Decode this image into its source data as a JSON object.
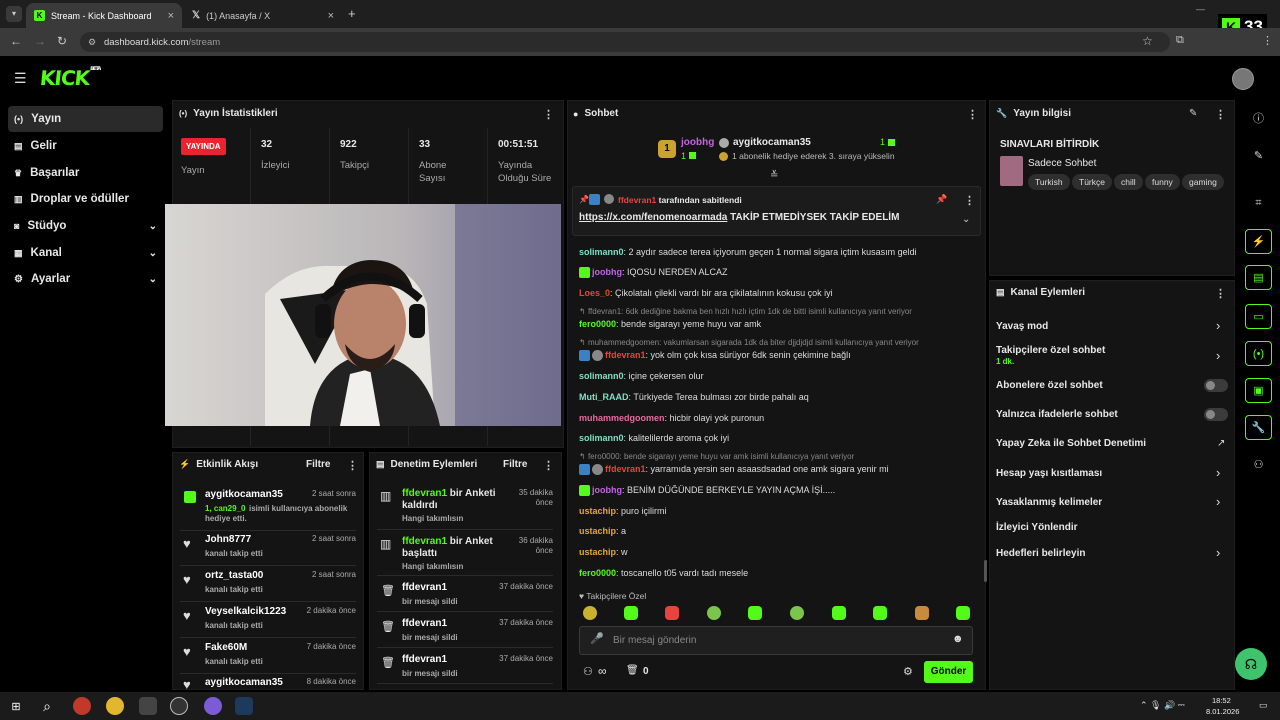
{
  "browser": {
    "tabs": [
      {
        "label": "Stream - Kick Dashboard",
        "active": true
      },
      {
        "label": "(1) Anasayfa / X",
        "active": false
      }
    ],
    "new_tab": "+",
    "url_domain": "dashboard.kick.com",
    "url_path": "/stream",
    "kick_badge": "33"
  },
  "sidebar": {
    "items": [
      {
        "label": "Yayın",
        "icon": "broadcast-icon"
      },
      {
        "label": "Gelir",
        "icon": "revenue-icon"
      },
      {
        "label": "Başarılar",
        "icon": "trophy-icon"
      },
      {
        "label": "Droplar ve ödüller",
        "icon": "gift-icon"
      },
      {
        "label": "Stüdyo",
        "icon": "studio-icon"
      },
      {
        "label": "Kanal",
        "icon": "channel-icon"
      },
      {
        "label": "Ayarlar",
        "icon": "gear-icon"
      }
    ]
  },
  "stats": {
    "title": "Yayın İstatistikleri",
    "live_badge": "YAYINDA",
    "live_label": "Yayın",
    "items": [
      {
        "value": "32",
        "label": "İzleyici"
      },
      {
        "value": "922",
        "label": "Takipçi"
      },
      {
        "value": "33",
        "label": "Abone Sayısı"
      },
      {
        "value": "00:51:51",
        "label": "Yayında Olduğu Süre"
      }
    ]
  },
  "activity": {
    "title": "Etkinlik Akışı",
    "filter": "Filtre",
    "items": [
      {
        "name": "aygitkocaman35",
        "time": "2 saat sonra",
        "sub_green": "1, can29_0",
        "sub": "isimli kullanıcıya abonelik hediye etti."
      },
      {
        "name": "John8777",
        "time": "2 saat sonra",
        "sub": "kanalı takip etti"
      },
      {
        "name": "ortz_tasta00",
        "time": "2 saat sonra",
        "sub": "kanalı takip etti"
      },
      {
        "name": "Veyselkalcik1223",
        "time": "2 dakika önce",
        "sub": "kanalı takip etti"
      },
      {
        "name": "Fake60M",
        "time": "7 dakika önce",
        "sub": "kanalı takip etti"
      },
      {
        "name": "aygitkocaman35",
        "time": "8 dakika önce",
        "sub": ""
      }
    ]
  },
  "moderation": {
    "title": "Denetim Eylemleri",
    "filter": "Filtre",
    "items": [
      {
        "name": "ffdevran1",
        "action": "bir Anketi kaldırdı",
        "time": "35 dakika önce",
        "sub": "Hangi takımlısın"
      },
      {
        "name": "ffdevran1",
        "action": "bir Anket başlattı",
        "time": "36 dakika önce",
        "sub": "Hangi takımlısın"
      },
      {
        "name": "ffdevran1",
        "action": "",
        "time": "37 dakika önce",
        "sub": "bir mesajı sildi"
      },
      {
        "name": "ffdevran1",
        "action": "",
        "time": "37 dakika önce",
        "sub": "bir mesajı sildi"
      },
      {
        "name": "ffdevran1",
        "action": "",
        "time": "37 dakika önce",
        "sub": "bir mesajı sildi"
      }
    ]
  },
  "chat": {
    "title": "Sohbet",
    "top_gifter": {
      "rank": "1",
      "name": "joobhg",
      "count": "1"
    },
    "gift_user": "aygitkocaman35",
    "gift_count": "1",
    "gift_text": "1 abonelik hediye ederek 3. sıraya yükselin",
    "pinned_by_user": "ffdevran1",
    "pinned_by_text": "tarafından sabitlendi",
    "pinned_link": "https://x.com/fenomenoarmada",
    "pinned_text": "TAKİP ETMEDİYSEK TAKİP EDELİM",
    "messages": [
      {
        "user": "solimann0",
        "color": "#7ee0c2",
        "text": "2 aydır sadece terea içiyorum geçen 1 normal sigara içtim kusasım geldi"
      },
      {
        "user": "joobhg",
        "color": "#c563e4",
        "text": "IQOSU NERDEN ALCAZ",
        "badge": true
      },
      {
        "user": "Loes_0",
        "color": "#e6453d",
        "text": "Çikolatalı çilekli vardı bir ara çikilatalının kokusu çok iyi"
      },
      {
        "reply": "ffdevran1: 6dk dediğine bakma ben hızlı hızlı içtim 1dk de bitti isimli kullanıcıya yanıt veriyor"
      },
      {
        "user": "fero0000",
        "color": "#53fc18",
        "text": "bende sigarayı yeme huyu var amk"
      },
      {
        "reply": "muhammedgoomen: vakumlarsan sigarada 1dk da biter djjdjdjd isimli kullanıcıya yanıt veriyor"
      },
      {
        "user": "ffdevran1",
        "color": "#e6453d",
        "text": "yok olm çok kısa sürüyor 6dk senin çekimine bağlı",
        "badge": true
      },
      {
        "user": "solimann0",
        "color": "#7ee0c2",
        "text": "içine çekersen olur"
      },
      {
        "user": "Muti_RAAD",
        "color": "#7ee0c2",
        "text": "Türkiyede Terea bulması zor birde pahalı aq"
      },
      {
        "user": "muhammedgoomen",
        "color": "#e46aa0",
        "text": "hicbir olayi yok puronun"
      },
      {
        "user": "solimann0",
        "color": "#7ee0c2",
        "text": "kalitelilerde aroma çok iyi"
      },
      {
        "reply": "fero0000: bende sigarayı yeme huyu var amk isimli kullanıcıya yanıt veriyor"
      },
      {
        "user": "ffdevran1",
        "color": "#e6453d",
        "text": "yarramıda yersin sen asaasdsadad one amk sigara yenir mi",
        "badge": true
      },
      {
        "user": "joobhg",
        "color": "#c563e4",
        "text": "BENİM DÜĞÜNDE BERKEYLE YAYIN AÇMA İŞİ.....",
        "badge": true
      },
      {
        "user": "ustachip",
        "color": "#e8a33a",
        "text": "puro içilirmi"
      },
      {
        "user": "ustachip",
        "color": "#e8a33a",
        "text": "a"
      },
      {
        "user": "ustachip",
        "color": "#e8a33a",
        "text": "w"
      },
      {
        "user": "fero0000",
        "color": "#53fc18",
        "text": "toscanello t05 vardı tadı mesele"
      }
    ],
    "followers_only_label": "Takipçilere Özel",
    "input_placeholder": "Bir mesaj gönderin",
    "infinity": "∞",
    "count": "0",
    "send_label": "Gönder"
  },
  "stream_info": {
    "title": "Yayın bilgisi",
    "stream_title": "SINAVLARI BİTİRDİK",
    "category": "Sadece Sohbet",
    "tags": [
      "Turkish",
      "Türkçe",
      "chill",
      "funny",
      "gaming"
    ]
  },
  "channel_actions": {
    "title": "Kanal Eylemleri",
    "items": [
      {
        "label": "Yavaş mod",
        "control": "chevron"
      },
      {
        "label": "Takipçilere özel sohbet",
        "sub": "1 dk.",
        "control": "chevron"
      },
      {
        "label": "Abonelere özel sohbet",
        "control": "toggle"
      },
      {
        "label": "Yalnızca ifadelerle sohbet",
        "control": "toggle"
      },
      {
        "label": "Yapay Zeka ile Sohbet Denetimi",
        "control": "external"
      },
      {
        "label": "Hesap yaşı kısıtlaması",
        "control": "chevron"
      },
      {
        "label": "Yasaklanmış kelimeler",
        "control": "chevron"
      },
      {
        "label": "İzleyici Yönlendir",
        "control": "none"
      },
      {
        "label": "Hedefleri belirleyin",
        "control": "chevron"
      }
    ]
  },
  "taskbar": {
    "time": "18:52",
    "date": "8.01.2026"
  },
  "colors": {
    "accent": "#53fc18",
    "live": "#e9242e",
    "panel": "#141414"
  }
}
